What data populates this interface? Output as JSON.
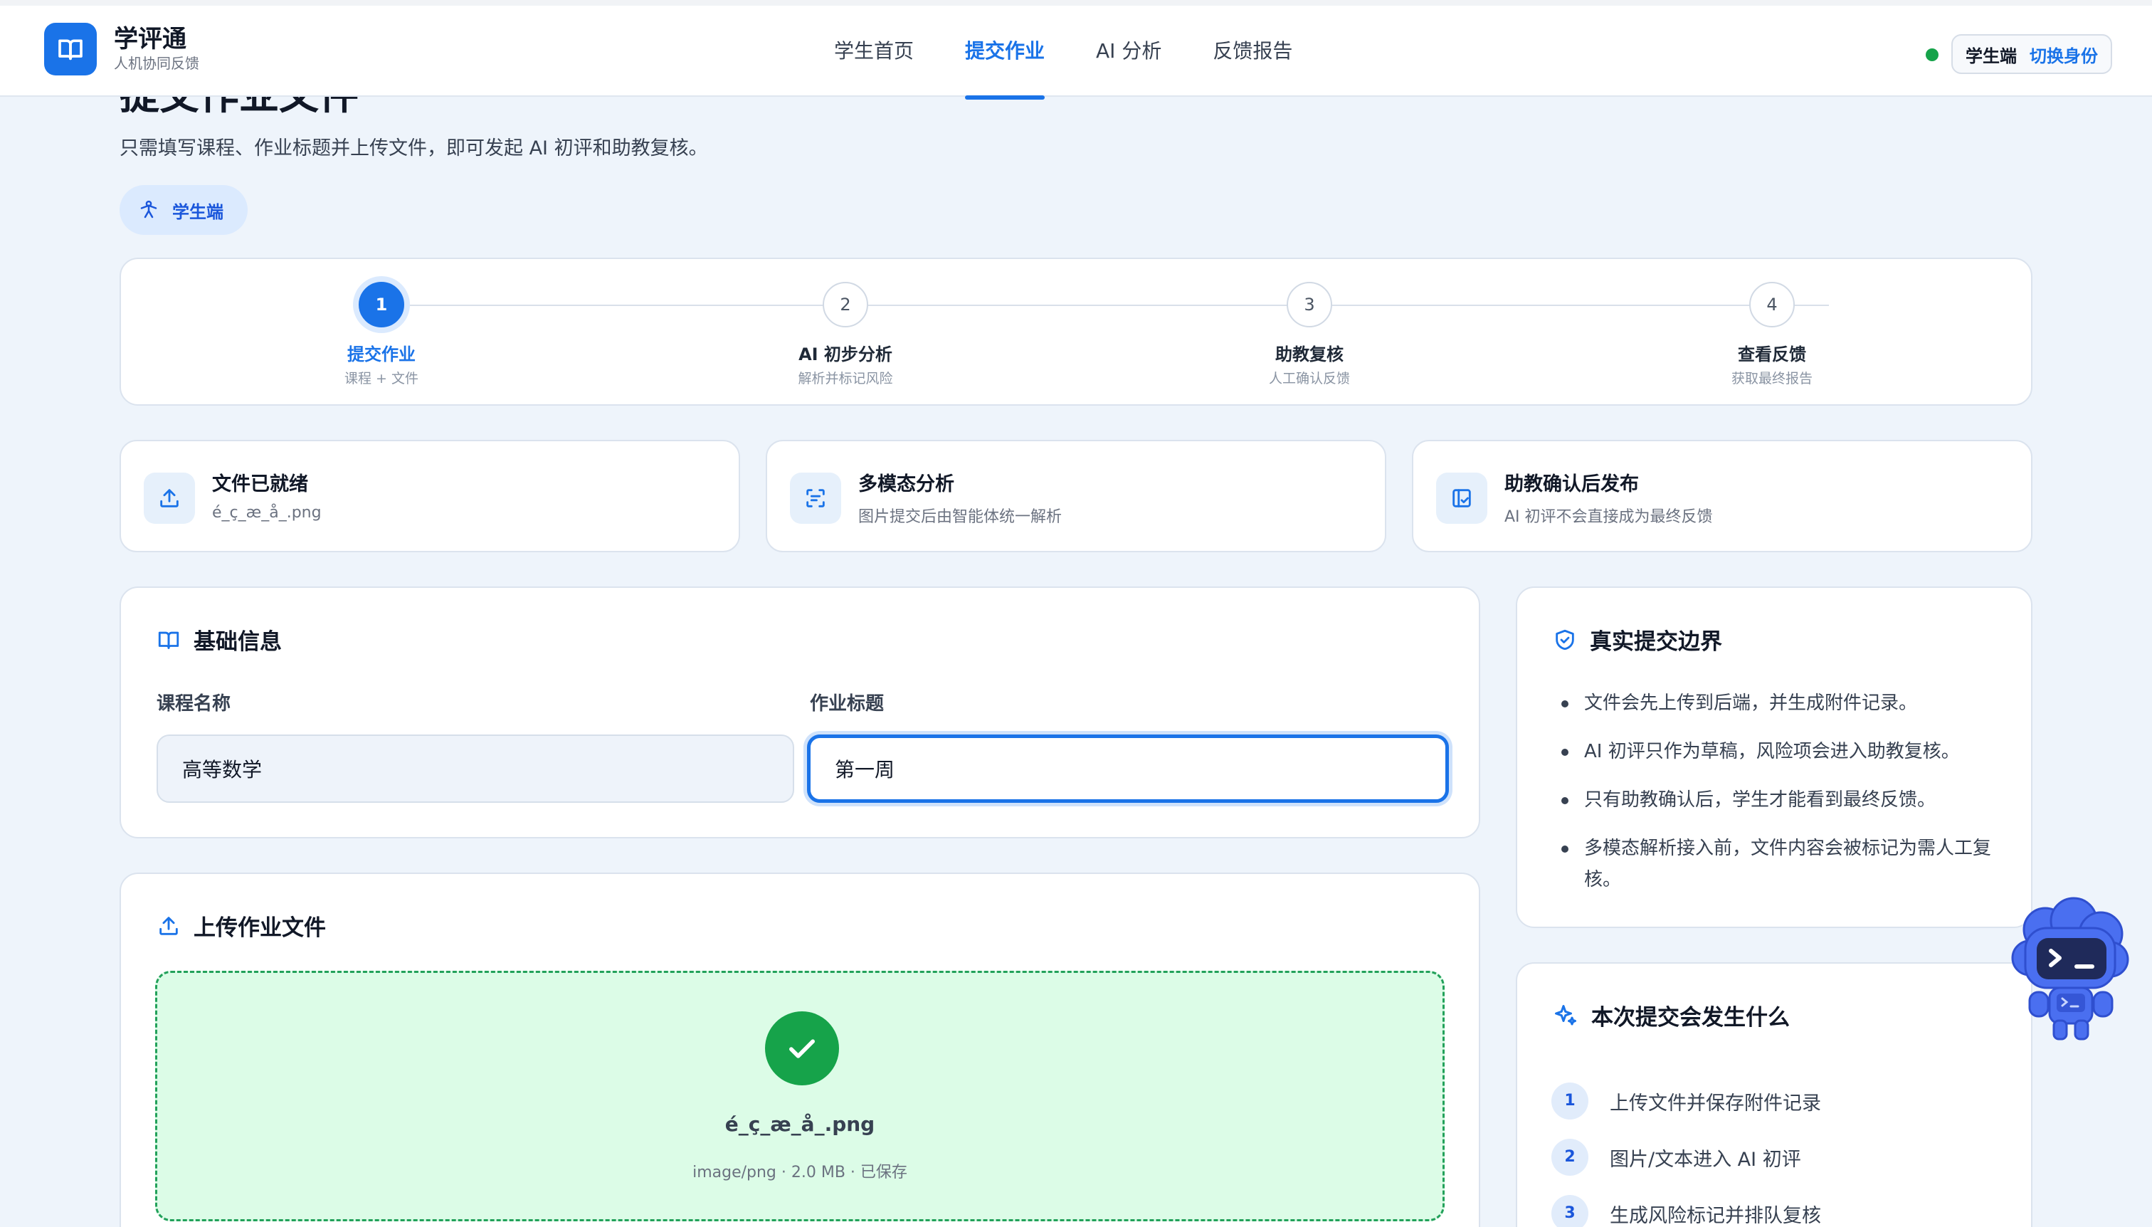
{
  "brand": {
    "title": "学评通",
    "subtitle": "人机协同反馈"
  },
  "nav": {
    "items": [
      "学生首页",
      "提交作业",
      "AI 分析",
      "反馈报告"
    ],
    "active": 1
  },
  "role": {
    "current": "学生端",
    "switch": "切换身份",
    "status_color": "#16a34a"
  },
  "page": {
    "title": "提交作业文件",
    "description": "只需填写课程、作业标题并上传文件，即可发起 AI 初评和助教复核。",
    "badge": "学生端"
  },
  "steps": [
    {
      "num": "1",
      "label": "提交作业",
      "sub": "课程 + 文件",
      "active": true
    },
    {
      "num": "2",
      "label": "AI 初步分析",
      "sub": "解析并标记风险",
      "active": false
    },
    {
      "num": "3",
      "label": "助教复核",
      "sub": "人工确认反馈",
      "active": false
    },
    {
      "num": "4",
      "label": "查看反馈",
      "sub": "获取最终报告",
      "active": false
    }
  ],
  "info_cards": [
    {
      "title": "文件已就绪",
      "sub": "é_ç_æ_å_.png",
      "icon": "upload-icon"
    },
    {
      "title": "多模态分析",
      "sub": "图片提交后由智能体统一解析",
      "icon": "scan-icon"
    },
    {
      "title": "助教确认后发布",
      "sub": "AI 初评不会直接成为最终反馈",
      "icon": "review-icon"
    }
  ],
  "basic": {
    "title": "基础信息",
    "course_label": "课程名称",
    "course_value": "高等数学",
    "assignment_label": "作业标题",
    "assignment_value": "第一周"
  },
  "upload": {
    "title": "上传作业文件",
    "file_name": "é_ç_æ_å_.png",
    "file_meta": "image/png · 2.0 MB · 已保存"
  },
  "boundary": {
    "title": "真实提交边界",
    "items": [
      "文件会先上传到后端，并生成附件记录。",
      "AI 初评只作为草稿，风险项会进入助教复核。",
      "只有助教确认后，学生才能看到最终反馈。",
      "多模态解析接入前，文件内容会被标记为需人工复核。"
    ]
  },
  "happen": {
    "title": "本次提交会发生什么",
    "items": [
      {
        "num": "1",
        "text": "上传文件并保存附件记录"
      },
      {
        "num": "2",
        "text": "图片/文本进入 AI 初评"
      },
      {
        "num": "3",
        "text": "生成风险标记并排队复核"
      }
    ]
  },
  "colors": {
    "primary": "#1a73e8",
    "success": "#16a34a",
    "background": "#eef4fb"
  }
}
